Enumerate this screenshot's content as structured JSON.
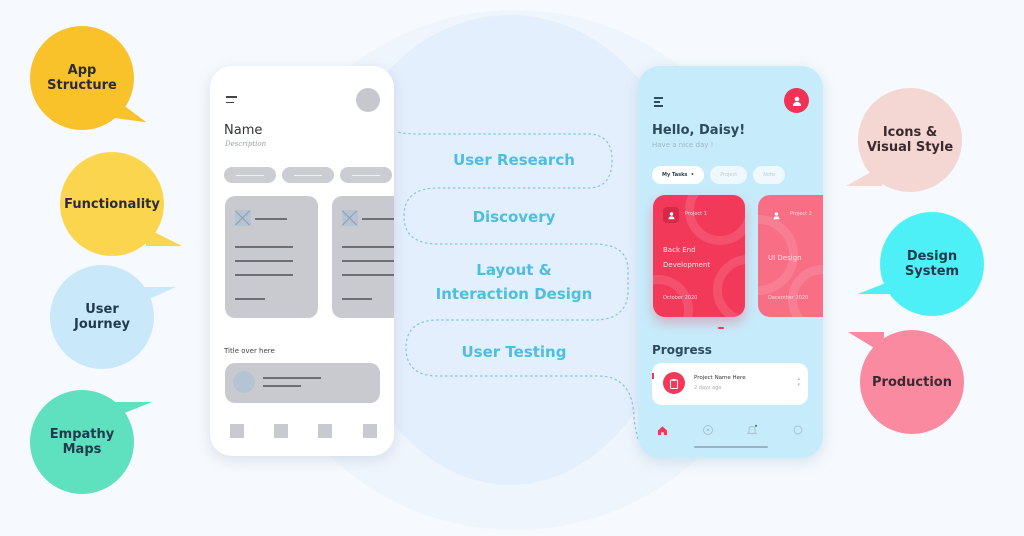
{
  "bubbles_left": [
    {
      "label_1": "App",
      "label_2": "Structure",
      "color": "#f9c22b"
    },
    {
      "label_1": "Functionality",
      "label_2": "",
      "color": "#fbd54e"
    },
    {
      "label_1": "User",
      "label_2": "Journey",
      "color": "#c9e9fb"
    },
    {
      "label_1": "Empathy",
      "label_2": "Maps",
      "color": "#5fe1bf"
    }
  ],
  "bubbles_right": [
    {
      "label_1": "Icons &",
      "label_2": "Visual Style",
      "color": "#f4d6d2"
    },
    {
      "label_1": "Design",
      "label_2": "System",
      "color": "#4ef0f7"
    },
    {
      "label_1": "Production",
      "label_2": "",
      "color": "#f98aa0"
    }
  ],
  "steps": [
    {
      "label_1": "User Research",
      "label_2": ""
    },
    {
      "label_1": "Discovery",
      "label_2": ""
    },
    {
      "label_1": "Layout &",
      "label_2": "Interaction Design"
    },
    {
      "label_1": "User Testing",
      "label_2": ""
    }
  ],
  "wireframe": {
    "name": "Name",
    "description": "Description",
    "section_title": "Title over here"
  },
  "app": {
    "greeting": "Hello, Daisy!",
    "subtitle": "Have a nice day !",
    "chips": [
      "My Tasks",
      "Project",
      "Note"
    ],
    "chip_active_suffix": "•",
    "cards": [
      {
        "project": "Project 1",
        "title_1": "Back End",
        "title_2": "Development",
        "date": "October 2020"
      },
      {
        "project": "Project 2",
        "title_1": "UI Design",
        "title_2": "",
        "date": "December 2020"
      }
    ],
    "progress_title": "Progress",
    "progress_item": {
      "name": "Project Name Here",
      "time": "2 days ago"
    },
    "accent": "#f2395a",
    "nav": [
      "home-icon",
      "compass-icon",
      "bell-icon",
      "search-icon"
    ]
  }
}
